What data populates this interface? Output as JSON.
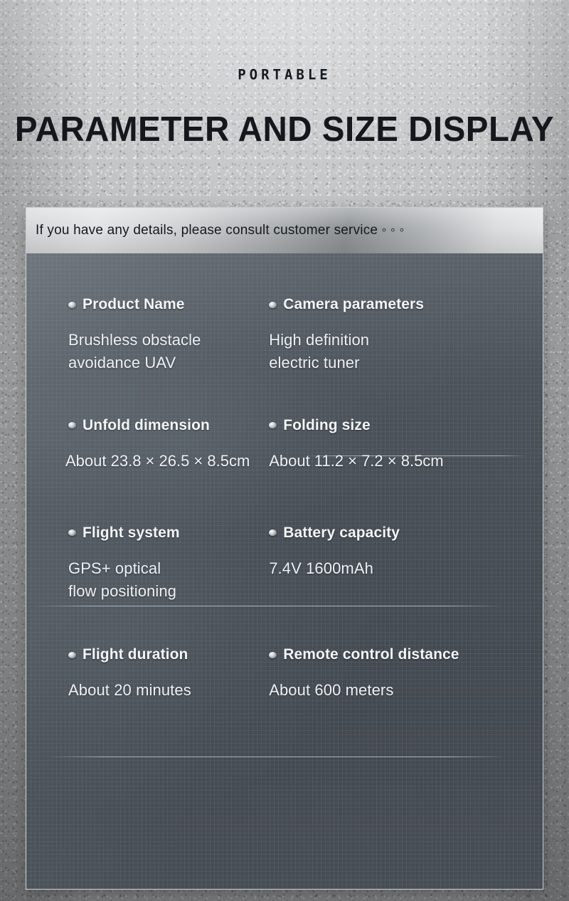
{
  "header": {
    "kicker": "PORTABLE",
    "title": "PARAMETER AND SIZE DISPLAY"
  },
  "panel": {
    "banner_text": "If you have any details, please consult customer service ◦ ◦ ◦",
    "rows": [
      {
        "left": {
          "label": "Product Name",
          "value": "Brushless obstacle\navoidance UAV"
        },
        "right": {
          "label": "Camera parameters",
          "value": "High definition\nelectric tuner"
        }
      },
      {
        "left": {
          "label": "Unfold dimension",
          "value": "About 23.8 × 26.5 × 8.5cm"
        },
        "right": {
          "label": "Folding size",
          "value": "About 11.2 × 7.2 × 8.5cm"
        }
      },
      {
        "left": {
          "label": "Flight system",
          "value": "GPS+ optical\nflow positioning"
        },
        "right": {
          "label": "Battery capacity",
          "value": "7.4V 1600mAh"
        }
      },
      {
        "left": {
          "label": "Flight duration",
          "value": "About 20 minutes"
        },
        "right": {
          "label": "Remote control distance",
          "value": "About 600 meters"
        }
      }
    ]
  },
  "colors": {
    "wall": "#b9bbbd",
    "panel_body": "#474d55",
    "banner_light": "#e1e3e4",
    "label_text": "#f3f5f7",
    "value_text": "#eef1f4",
    "title_text": "#14181d"
  }
}
